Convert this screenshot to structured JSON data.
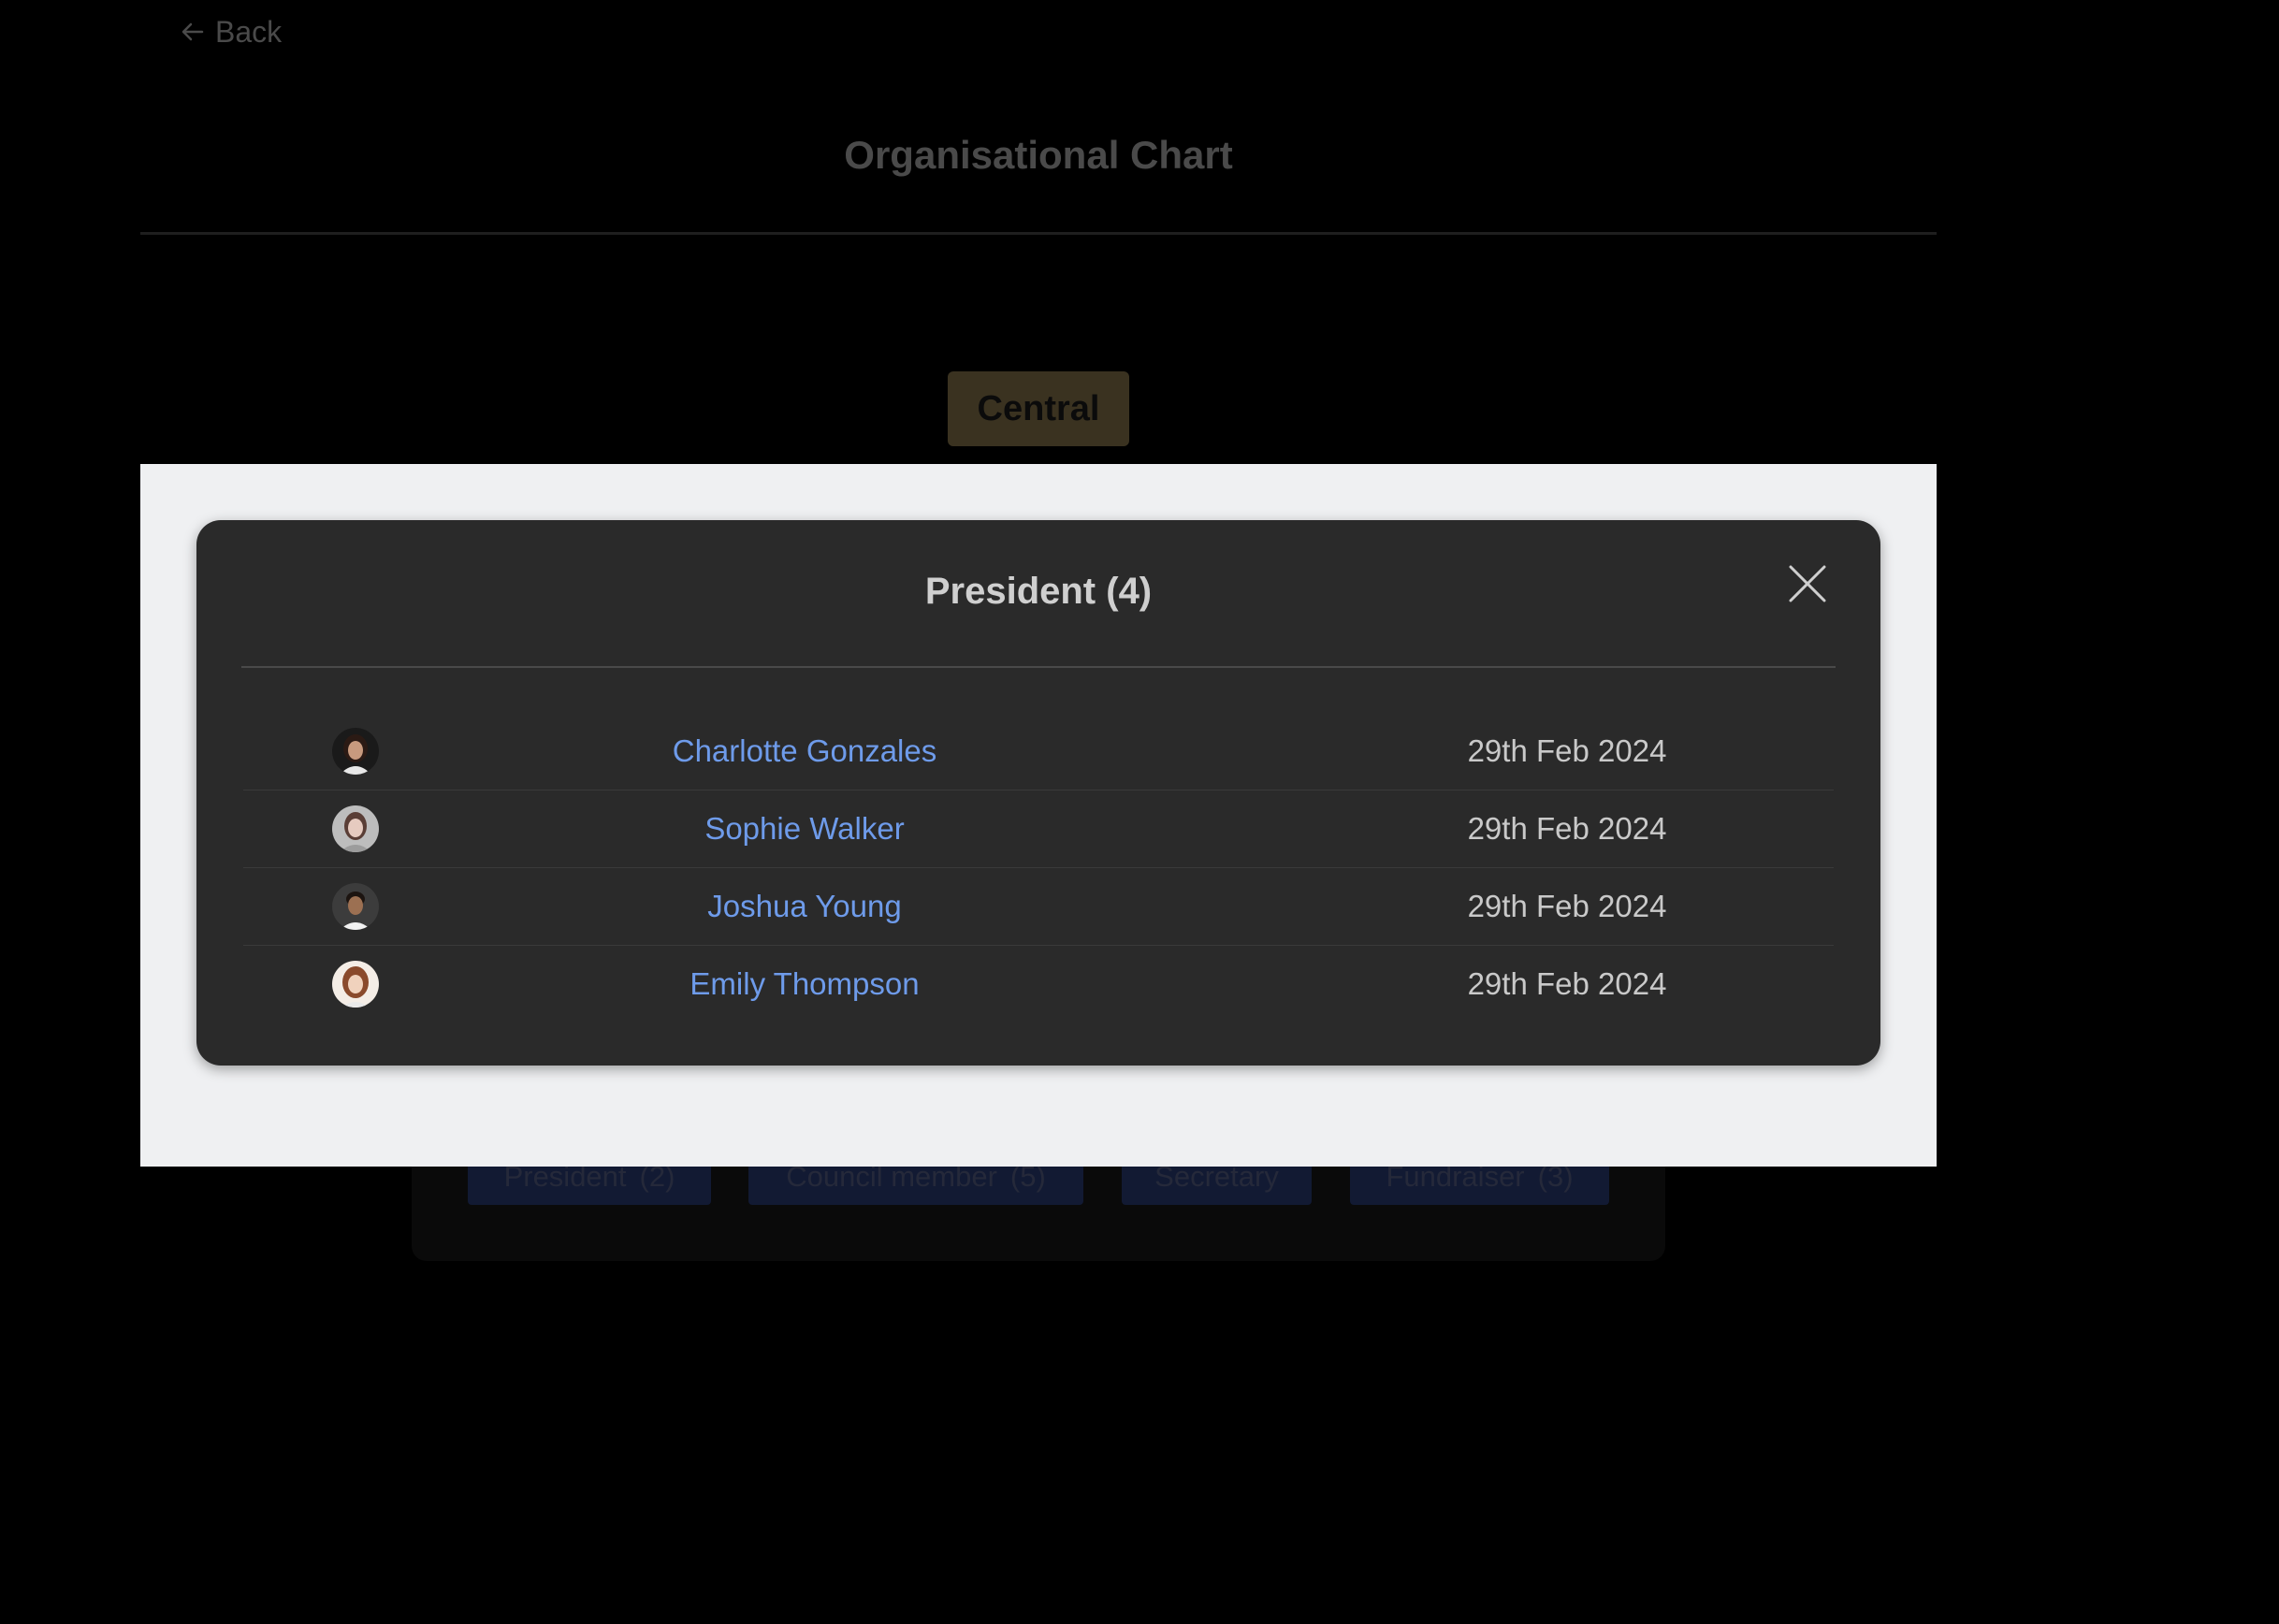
{
  "nav": {
    "back_label": "Back"
  },
  "page": {
    "title": "Organisational Chart",
    "central_node": "Central"
  },
  "role_chips": [
    {
      "label": "President",
      "count": "(2)"
    },
    {
      "label": "Council member",
      "count": "(5)"
    },
    {
      "label": "Secretary",
      "count": ""
    },
    {
      "label": "Fundraiser",
      "count": "(3)"
    }
  ],
  "modal": {
    "title": "President (4)",
    "close_icon": "close-icon",
    "members": [
      {
        "name": "Charlotte Gonzales",
        "date": "29th Feb 2024"
      },
      {
        "name": "Sophie Walker",
        "date": "29th Feb 2024"
      },
      {
        "name": "Joshua Young",
        "date": "29th Feb 2024"
      },
      {
        "name": "Emily Thompson",
        "date": "29th Feb 2024"
      }
    ]
  },
  "colors": {
    "link": "#6e9bea",
    "modal_bg": "#2a2a2a",
    "backdrop": "#eff0f2",
    "central_node": "#3a3220"
  }
}
